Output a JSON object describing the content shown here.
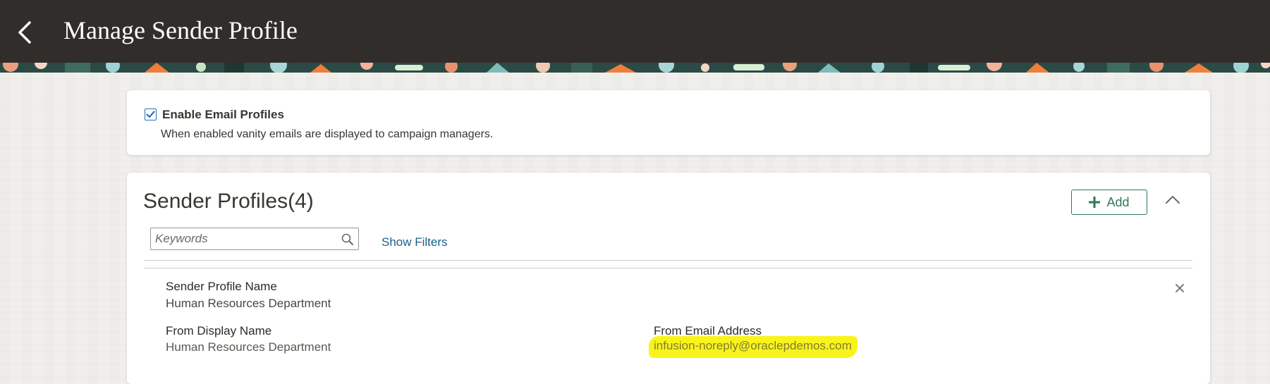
{
  "header": {
    "title": "Manage Sender Profile"
  },
  "email_profiles": {
    "checkbox_label": "Enable Email Profiles",
    "checked": true,
    "description": "When enabled vanity emails are displayed to campaign managers."
  },
  "sender_profiles": {
    "title": "Sender Profiles(4)",
    "add_label": "Add",
    "search_placeholder": "Keywords",
    "show_filters_label": "Show Filters",
    "profile": {
      "name_label": "Sender Profile Name",
      "name_value": "Human Resources Department",
      "display_label": "From Display Name",
      "display_value": "Human Resources Department",
      "email_label": "From Email Address",
      "email_value": "infusion-noreply@oraclepdemos.com"
    }
  },
  "colors": {
    "header_bg": "#312d2a",
    "accent_green": "#2e7a55",
    "link_blue": "#1b5f86",
    "highlight_yellow": "#f9f31c"
  }
}
